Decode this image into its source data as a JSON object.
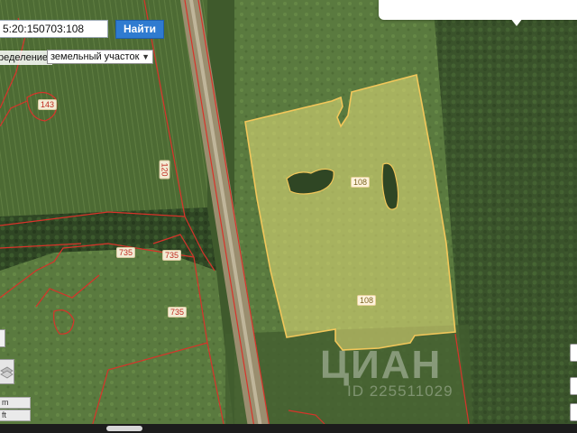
{
  "search": {
    "value": "5:20:150703:108",
    "button_label": "Найти"
  },
  "definition": {
    "label": "ределение:",
    "selected": "земельный участок"
  },
  "parcels": {
    "label_143": "143",
    "label_120": "120",
    "label_735_a": "735",
    "label_735_b": "735",
    "label_735_c": "735",
    "label_108_top": "108",
    "label_108_bottom": "108"
  },
  "scale": {
    "unit_m": "m",
    "unit_ft": "ft"
  },
  "watermark": {
    "brand": "ЦИАН",
    "id": "ID 225511029"
  },
  "colors": {
    "selected_parcel_fill": "#e8e07a",
    "selected_parcel_border": "#f2c75a",
    "boundary_red": "#d8332a",
    "button_blue": "#2f7bd0"
  }
}
